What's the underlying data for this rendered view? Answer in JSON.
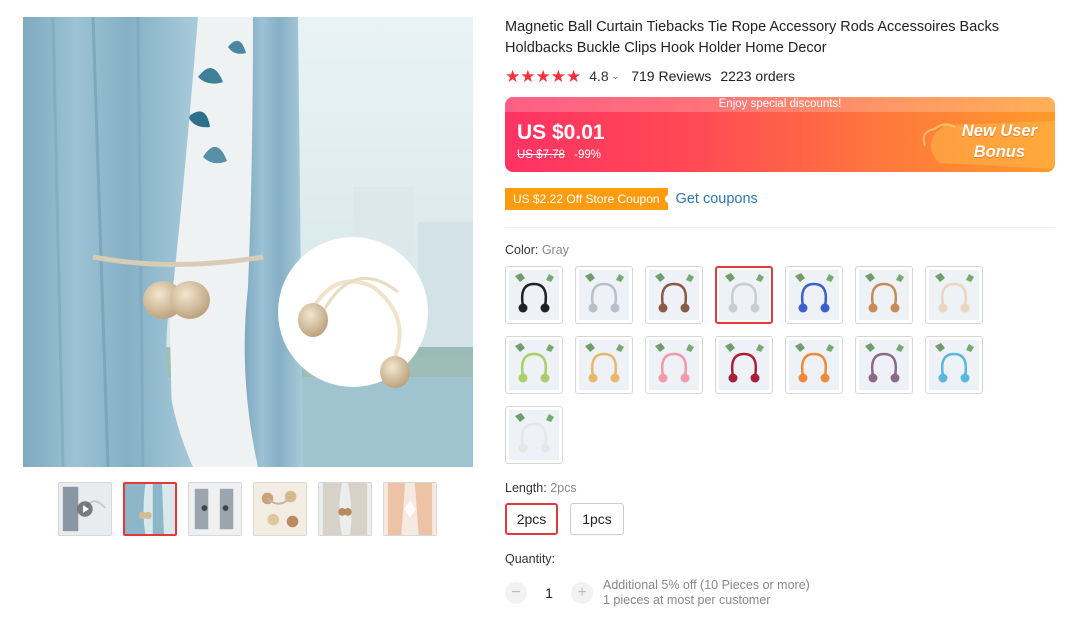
{
  "product": {
    "title": "Magnetic Ball Curtain Tiebacks Tie Rope Accessory Rods Accessoires Backs Holdbacks Buckle Clips Hook Holder Home Decor",
    "stars": "★★★★★",
    "rating": "4.8",
    "rating_caret": "⌄",
    "reviews": "719 Reviews",
    "orders": "2223 orders"
  },
  "price": {
    "banner_note": "Enjoy special discounts!",
    "current": "US $0.01",
    "original": "US $7.78",
    "discount": "-99%",
    "bonus_line1": "New User",
    "bonus_line2": "Bonus",
    "colors": {
      "gradient_start": "#ff3264",
      "gradient_end": "#ff9a2a"
    }
  },
  "coupon": {
    "badge": "US $2.22 Off Store Coupon",
    "link": "Get coupons",
    "badge_color": "#ff9b0f",
    "link_color": "#2e77b5"
  },
  "color_option": {
    "label": "Color:",
    "selected": "Gray",
    "swatches": [
      {
        "name": "black",
        "color": "#222222"
      },
      {
        "name": "light-gray",
        "color": "#b8c0cc"
      },
      {
        "name": "brown",
        "color": "#8a5a44"
      },
      {
        "name": "gray",
        "color": "#c8ccd4",
        "selected": true
      },
      {
        "name": "blue",
        "color": "#3a5fcf"
      },
      {
        "name": "camel",
        "color": "#c98a55"
      },
      {
        "name": "beige",
        "color": "#e8d6c0"
      },
      {
        "name": "green",
        "color": "#a8cf6a"
      },
      {
        "name": "gold",
        "color": "#e8b86a"
      },
      {
        "name": "pink",
        "color": "#f29aa8"
      },
      {
        "name": "wine",
        "color": "#a8203a"
      },
      {
        "name": "orange",
        "color": "#f08a3a"
      },
      {
        "name": "purple",
        "color": "#8a6a8a"
      },
      {
        "name": "sky-blue",
        "color": "#5ab8e0"
      },
      {
        "name": "white",
        "color": "#e6e6e6"
      }
    ]
  },
  "length_option": {
    "label": "Length:",
    "selected": "2pcs",
    "options": [
      "2pcs",
      "1pcs"
    ]
  },
  "quantity": {
    "label": "Quantity:",
    "minus": "−",
    "plus": "+",
    "value": "1",
    "note_line1": "Additional 5% off (10 Pieces or more)",
    "note_line2": "1 pieces at most per customer"
  },
  "gallery": {
    "thumbnails": [
      "video-thumbnail",
      "curtain-blue",
      "curtain-gray-pair",
      "tieback-set",
      "curtain-white",
      "curtain-peach"
    ],
    "active_index": 1
  }
}
